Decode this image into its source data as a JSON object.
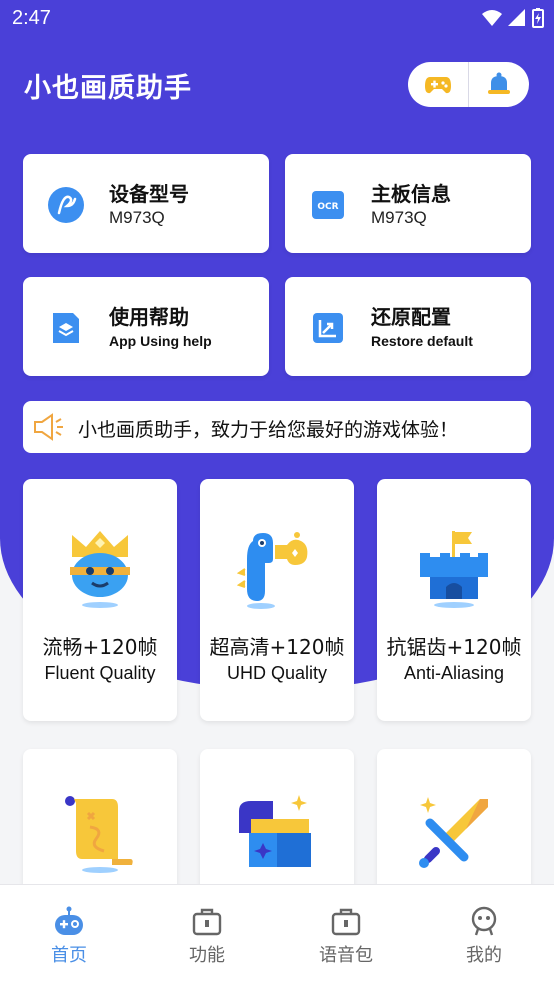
{
  "status_bar": {
    "time": "2:47"
  },
  "header": {
    "title": "小也画质助手",
    "icons": [
      "gamepad-icon",
      "bell-icon"
    ]
  },
  "info_cards": [
    {
      "title": "设备型号",
      "subtitle": "M973Q",
      "icon": "stylus-icon"
    },
    {
      "title": "主板信息",
      "subtitle": "M973Q",
      "icon": "ocr-icon"
    },
    {
      "title": "使用帮助",
      "subtitle": "App Using help",
      "icon": "layers-icon"
    },
    {
      "title": "还原配置",
      "subtitle": "Restore default",
      "icon": "chart-icon"
    }
  ],
  "notice": {
    "text": "小也画质助手，致力于给您最好的游戏体验！",
    "icon": "speaker-icon"
  },
  "modes": [
    {
      "title": "流畅+120帧",
      "subtitle": "Fluent Quality",
      "icon": "king-icon"
    },
    {
      "title": "超高清+120帧",
      "subtitle": "UHD Quality",
      "icon": "dinosaur-icon"
    },
    {
      "title": "抗锯齿+120帧",
      "subtitle": "Anti-Aliasing",
      "icon": "castle-icon"
    }
  ],
  "tiles": [
    {
      "icon": "scroll-map-icon"
    },
    {
      "icon": "treasure-chest-icon"
    },
    {
      "icon": "sword-icon"
    }
  ],
  "nav": [
    {
      "label": "首页",
      "icon": "robot-icon",
      "active": true
    },
    {
      "label": "功能",
      "icon": "toolbox-icon",
      "active": false
    },
    {
      "label": "语音包",
      "icon": "briefcase-icon",
      "active": false
    },
    {
      "label": "我的",
      "icon": "profile-icon",
      "active": false
    }
  ],
  "colors": {
    "primary": "#4a40d8",
    "active_nav": "#4a8fe6",
    "background": "#f4f5f7"
  }
}
